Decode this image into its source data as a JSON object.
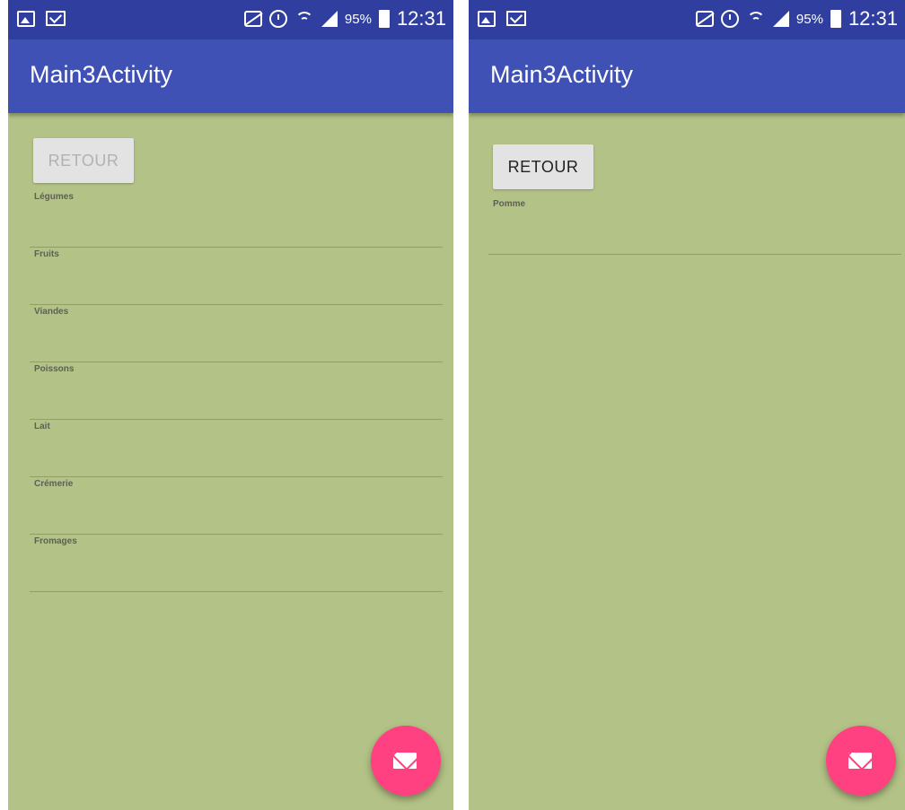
{
  "status_bar": {
    "battery_percent": "95%",
    "time": "12:31"
  },
  "left_screen": {
    "app_title": "Main3Activity",
    "retour_label": "RETOUR",
    "retour_enabled": false,
    "categories": [
      "Légumes",
      "Fruits",
      "Viandes",
      "Poissons",
      "Lait",
      "Crémerie",
      "Fromages"
    ]
  },
  "right_screen": {
    "app_title": "Main3Activity",
    "retour_label": "RETOUR",
    "retour_enabled": true,
    "items": [
      "Pomme"
    ]
  },
  "colors": {
    "status_bar": "#303f9f",
    "app_bar": "#3f51b5",
    "background": "#b3c286",
    "fab": "#ff4081"
  },
  "icons": {
    "status_left": [
      "gallery-icon",
      "mail-icon"
    ],
    "status_right": [
      "mute-icon",
      "alarm-icon",
      "wifi-icon",
      "signal-icon",
      "battery-icon"
    ],
    "fab": "envelope-icon"
  }
}
